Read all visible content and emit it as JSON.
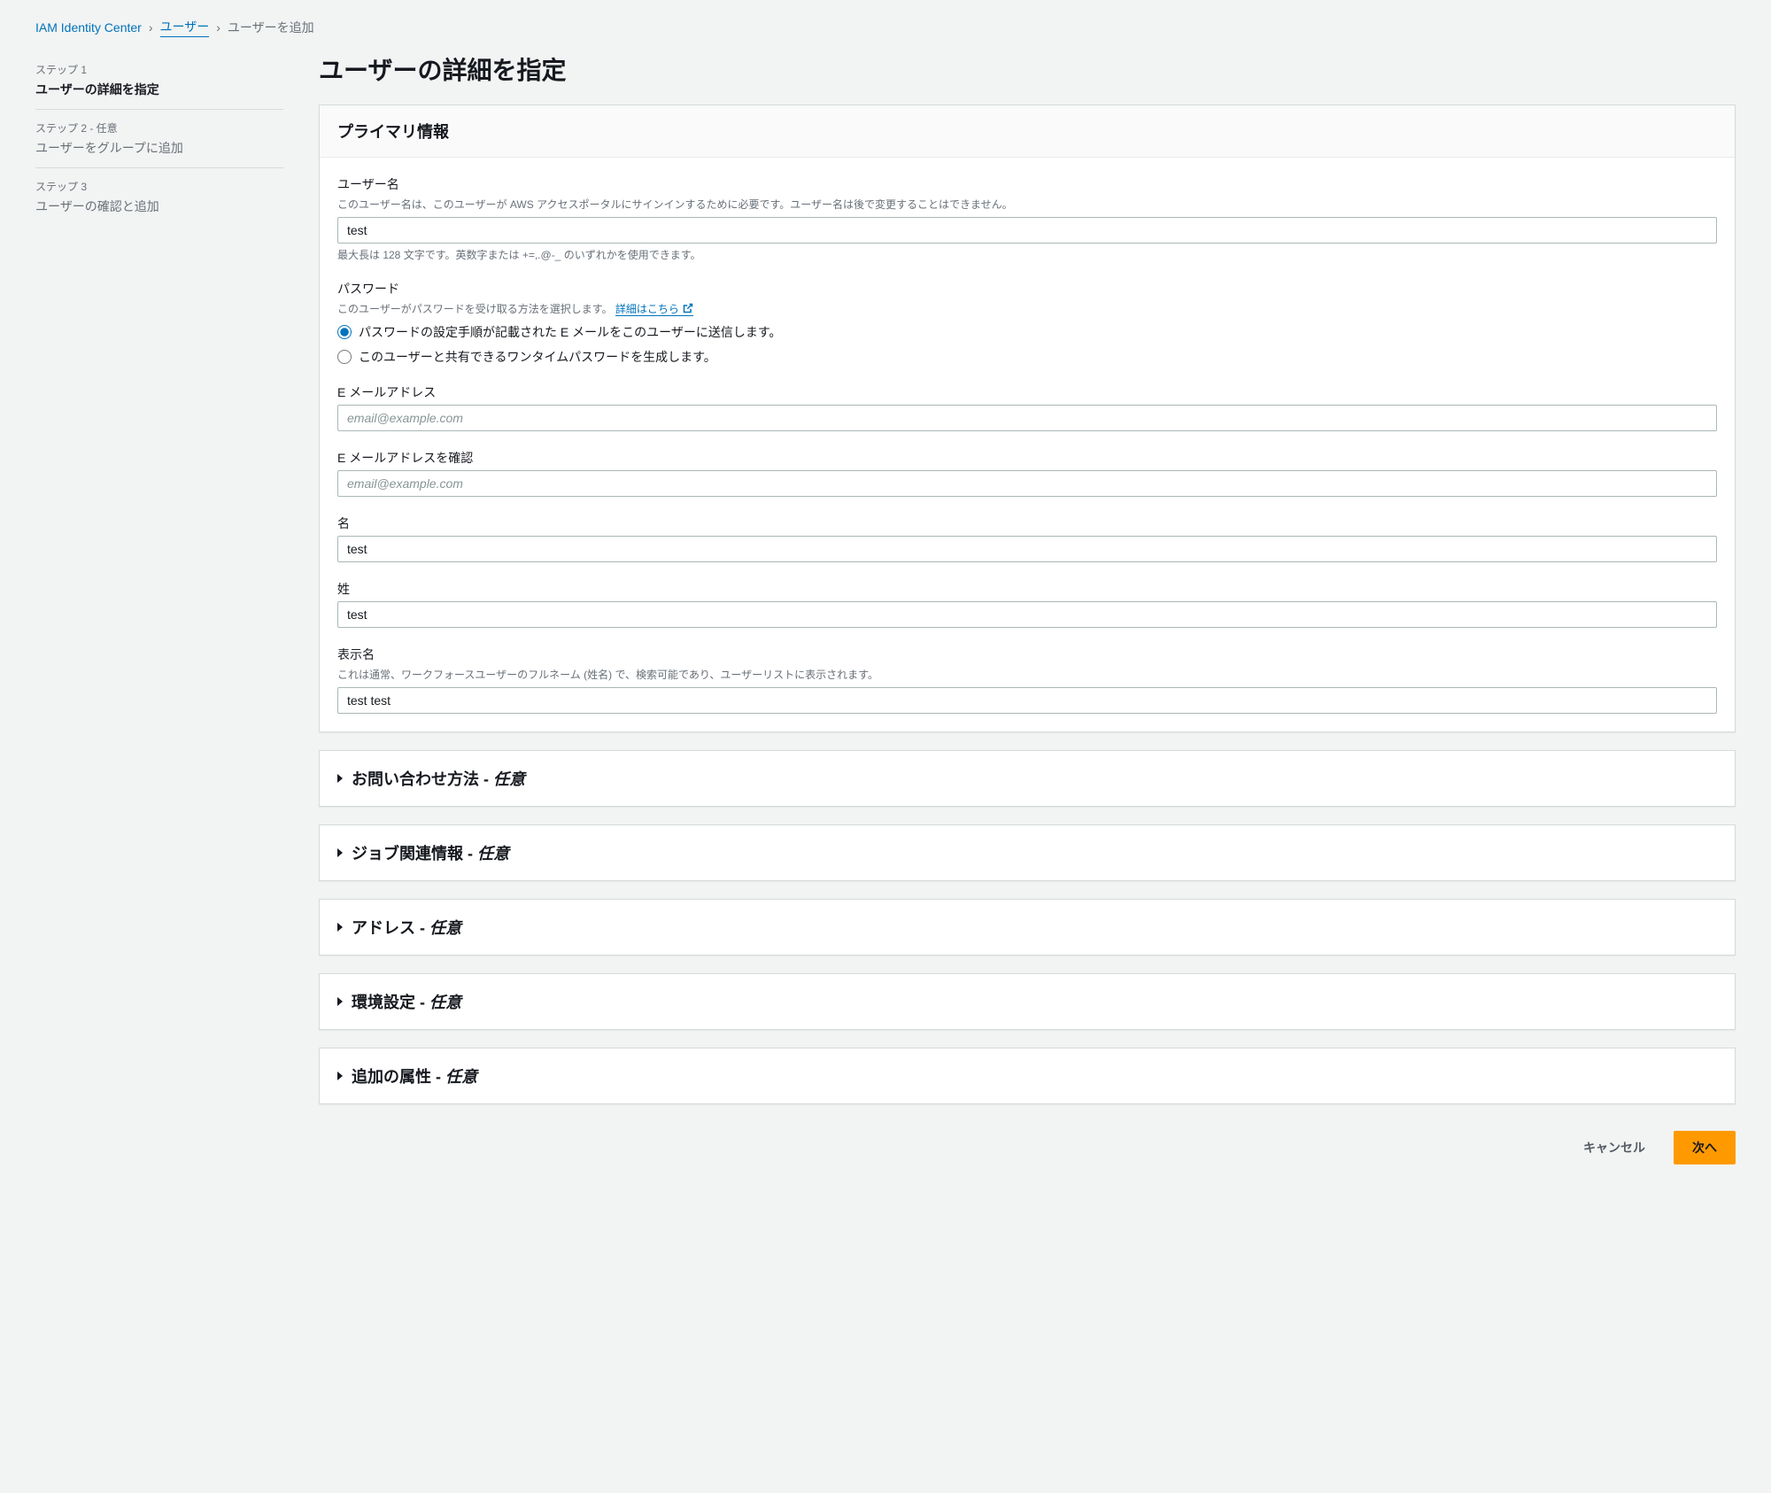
{
  "breadcrumb": {
    "root": "IAM Identity Center",
    "users": "ユーザー",
    "current": "ユーザーを追加"
  },
  "steps": [
    {
      "num": "ステップ 1",
      "title": "ユーザーの詳細を指定"
    },
    {
      "num": "ステップ 2 - 任意",
      "title": "ユーザーをグループに追加"
    },
    {
      "num": "ステップ 3",
      "title": "ユーザーの確認と追加"
    }
  ],
  "page_title": "ユーザーの詳細を指定",
  "primary_panel_title": "プライマリ情報",
  "fields": {
    "username": {
      "label": "ユーザー名",
      "description": "このユーザー名は、このユーザーが AWS アクセスポータルにサインインするために必要です。ユーザー名は後で変更することはできません。",
      "value": "test",
      "hint": "最大長は 128 文字です。英数字または +=,.@-_ のいずれかを使用できます。"
    },
    "password": {
      "label": "パスワード",
      "description_prefix": "このユーザーがパスワードを受け取る方法を選択します。 ",
      "learn_more": "詳細はこちら",
      "option1": "パスワードの設定手順が記載された E メールをこのユーザーに送信します。",
      "option2": "このユーザーと共有できるワンタイムパスワードを生成します。"
    },
    "email": {
      "label": "E メールアドレス",
      "placeholder": "email@example.com",
      "value": ""
    },
    "email_confirm": {
      "label": "E メールアドレスを確認",
      "placeholder": "email@example.com",
      "value": ""
    },
    "first_name": {
      "label": "名",
      "value": "test"
    },
    "last_name": {
      "label": "姓",
      "value": "test"
    },
    "display_name": {
      "label": "表示名",
      "description": "これは通常、ワークフォースユーザーのフルネーム (姓名) で、検索可能であり、ユーザーリストに表示されます。",
      "value": "test test"
    }
  },
  "expandable_sections": {
    "contact": {
      "title": "お問い合わせ方法 - ",
      "suffix": "任意"
    },
    "job": {
      "title": "ジョブ関連情報 - ",
      "suffix": "任意"
    },
    "address": {
      "title": "アドレス - ",
      "suffix": "任意"
    },
    "preferences": {
      "title": "環境設定 - ",
      "suffix": "任意"
    },
    "additional": {
      "title": "追加の属性 - ",
      "suffix": "任意"
    }
  },
  "footer": {
    "cancel": "キャンセル",
    "next": "次へ"
  }
}
